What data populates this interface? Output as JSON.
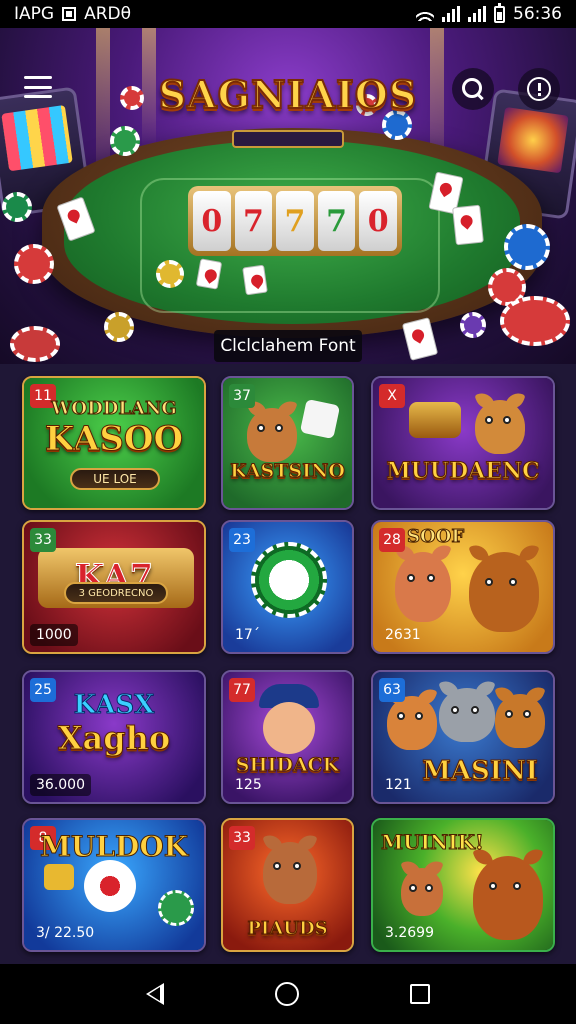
{
  "status_bar": {
    "left_text_1": "IAPG",
    "left_text_2": "ARDθ",
    "time": "56:36"
  },
  "header": {
    "logo_text": "SAGNIAIOS",
    "menu_icon": "hamburger-menu-icon",
    "search_icon": "search-icon",
    "info_icon": "info-icon"
  },
  "hero": {
    "reels": [
      "0",
      "7",
      "7",
      "7",
      "0"
    ],
    "caption": "Clсlсlаhem Font"
  },
  "tiles": [
    {
      "badge": "11",
      "badge_color": "red",
      "title_line1": "WODDLANG",
      "title_line2": "KASOO",
      "pill": "UE LOΕ",
      "count": "",
      "theme": "#2e8a2e"
    },
    {
      "badge": "37",
      "badge_color": "green",
      "title_line1": "",
      "title_line2": "KASTSINO",
      "pill": "",
      "count": "",
      "theme": "#2f7a34"
    },
    {
      "badge": "X",
      "badge_color": "red",
      "title_line1": "",
      "title_line2": "MUUDAENC",
      "pill": "",
      "count": "",
      "theme": "#5a2a86"
    },
    {
      "badge": "33",
      "badge_color": "green",
      "title_line1": "",
      "title_line2": "KA7",
      "pill": "3 GEODRECNO",
      "count": "1000",
      "theme": "#9a1f2a"
    },
    {
      "badge": "23",
      "badge_color": "blue",
      "title_line1": "",
      "title_line2": "",
      "pill": "",
      "count": "17´",
      "theme": "#1e4fa8"
    },
    {
      "badge": "28",
      "badge_color": "red",
      "title_line1": "SOOF",
      "title_line2": "",
      "pill": "",
      "count": "2631",
      "theme": "#e2a12a"
    },
    {
      "badge": "25",
      "badge_color": "blue",
      "title_line1": "KASX",
      "title_line2": "Xagho",
      "pill": "",
      "count": "36.000",
      "theme": "#4a2a8a"
    },
    {
      "badge": "77",
      "badge_color": "red",
      "title_line1": "",
      "title_line2": "SHIDACK",
      "pill": "",
      "count": "125",
      "theme": "#6a2a9a"
    },
    {
      "badge": "63",
      "badge_color": "blue",
      "title_line1": "",
      "title_line2": "MASINI",
      "pill": "",
      "count": "121",
      "theme": "#1f5a9a"
    },
    {
      "badge": "8",
      "badge_color": "red",
      "title_line1": "MULDOK",
      "title_line2": "",
      "pill": "",
      "count": "3/ 22.50",
      "theme": "#1c6ad0"
    },
    {
      "badge": "33",
      "badge_color": "red",
      "title_line1": "",
      "title_line2": "PIAUDS",
      "pill": "",
      "count": "",
      "theme": "#c8401a"
    },
    {
      "badge": "",
      "badge_color": "plain",
      "title_line1": "MUINIK!",
      "title_line2": "",
      "pill": "",
      "count": "3.2699",
      "theme": "#3a9a2a"
    }
  ],
  "nav": {
    "back_icon": "back-triangle-icon",
    "home_icon": "home-circle-icon",
    "recents_icon": "recents-square-icon"
  }
}
